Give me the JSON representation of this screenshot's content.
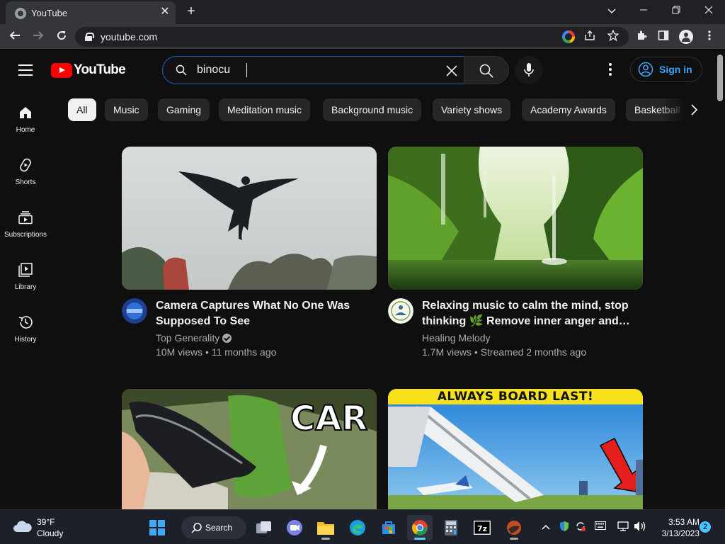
{
  "browser": {
    "tab_title": "YouTube",
    "url": "youtube.com",
    "new_tab_symbol": "+",
    "close_symbol": "✕"
  },
  "youtube": {
    "logo_text": "YouTube",
    "search": {
      "value": "binocu",
      "placeholder": "Search"
    },
    "signin_label": "Sign in",
    "accent_red": "#ff0000",
    "link_blue": "#3ea6ff"
  },
  "sidebar": {
    "items": [
      {
        "label": "Home",
        "icon": "home-icon"
      },
      {
        "label": "Shorts",
        "icon": "shorts-icon"
      },
      {
        "label": "Subscriptions",
        "icon": "subscriptions-icon"
      },
      {
        "label": "Library",
        "icon": "library-icon"
      },
      {
        "label": "History",
        "icon": "history-icon"
      }
    ]
  },
  "chips": [
    {
      "label": "All",
      "active": true
    },
    {
      "label": "Music"
    },
    {
      "label": "Gaming"
    },
    {
      "label": "Meditation music"
    },
    {
      "label": "Background music"
    },
    {
      "label": "Variety shows"
    },
    {
      "label": "Academy Awards"
    },
    {
      "label": "Basketball"
    }
  ],
  "videos": [
    {
      "title": "Camera Captures What No One Was Supposed To See",
      "channel": "Top Generality",
      "verified": true,
      "views": "10M views",
      "age": "11 months ago",
      "meta": "10M views • 11 months ago"
    },
    {
      "title": "Relaxing music to calm the mind, stop thinking 🌿 Remove inner anger and…",
      "channel": "Healing Melody",
      "verified": false,
      "views": "1.7M views",
      "age": "Streamed 2 months ago",
      "meta": "1.7M views • Streamed 2 months ago"
    },
    {
      "thumb_text": "CAR"
    },
    {
      "thumb_text": "ALWAYS BOARD LAST!"
    }
  ],
  "taskbar": {
    "weather_temp": "39°F",
    "weather_cond": "Cloudy",
    "search_label": "Search",
    "time": "3:53 AM",
    "date": "3/13/2023",
    "notification_count": "2"
  }
}
